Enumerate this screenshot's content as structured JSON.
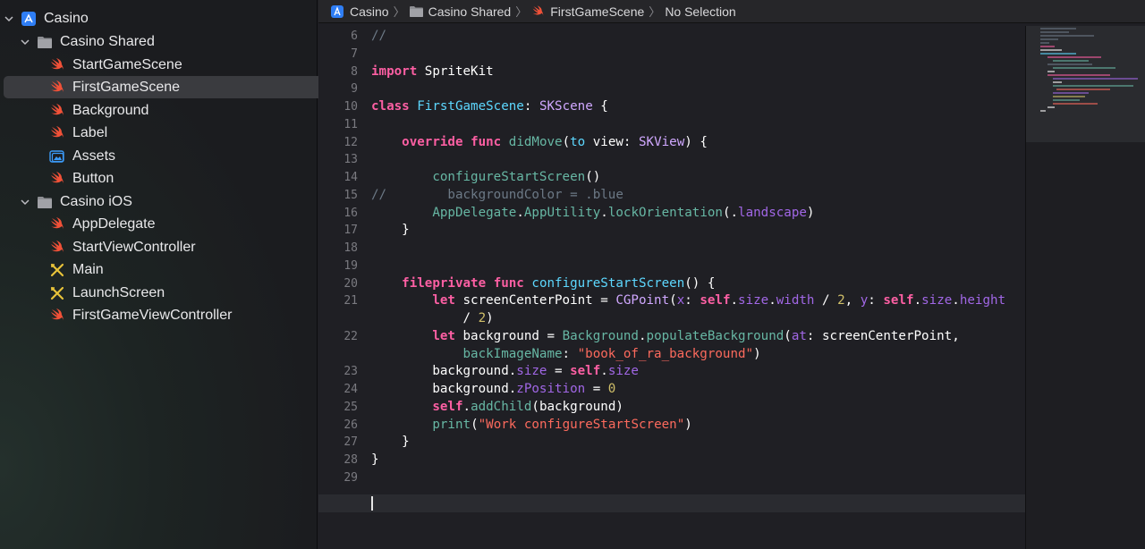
{
  "sidebar": {
    "project": {
      "label": "Casino",
      "icon": "xcode-project-icon"
    },
    "groups": [
      {
        "label": "Casino Shared",
        "icon": "folder-icon",
        "expanded": true
      },
      {
        "label": "Casino iOS",
        "icon": "folder-icon",
        "expanded": true
      }
    ],
    "items": [
      {
        "label": "StartGameScene",
        "icon": "swift-file-icon",
        "group": "Casino Shared"
      },
      {
        "label": "FirstGameScene",
        "icon": "swift-file-icon",
        "group": "Casino Shared",
        "selected": true
      },
      {
        "label": "Background",
        "icon": "swift-file-icon",
        "group": "Casino Shared"
      },
      {
        "label": "Label",
        "icon": "swift-file-icon",
        "group": "Casino Shared"
      },
      {
        "label": "Assets",
        "icon": "asset-catalog-icon",
        "group": "Casino Shared"
      },
      {
        "label": "Button",
        "icon": "swift-file-icon",
        "group": "Casino Shared"
      },
      {
        "label": "AppDelegate",
        "icon": "swift-file-icon",
        "group": "Casino iOS"
      },
      {
        "label": "StartViewController",
        "icon": "swift-file-icon",
        "group": "Casino iOS"
      },
      {
        "label": "Main",
        "icon": "storyboard-icon",
        "group": "Casino iOS"
      },
      {
        "label": "LaunchScreen",
        "icon": "storyboard-icon",
        "group": "Casino iOS"
      },
      {
        "label": "FirstGameViewController",
        "icon": "swift-file-icon",
        "group": "Casino iOS"
      }
    ]
  },
  "jumpbar": {
    "crumbs": [
      "Casino",
      "Casino Shared",
      "FirstGameScene",
      "No Selection"
    ]
  },
  "editor": {
    "line_numbers": [
      "6",
      "7",
      "8",
      "9",
      "10",
      "11",
      "12",
      "13",
      "14",
      "15",
      "16",
      "17",
      "18",
      "19",
      "20",
      "21",
      "",
      "22",
      "",
      "23",
      "24",
      "25",
      "26",
      "27",
      "28",
      "29"
    ],
    "current_line": "29"
  },
  "colors": {
    "keyword": "#fc5fa3",
    "type": "#5dd8ff",
    "function": "#67b7a4",
    "property": "#a167e6",
    "string": "#fc6a5d",
    "number": "#d0bf69",
    "comment": "#6c7986",
    "swift_orange": "#f05138"
  }
}
